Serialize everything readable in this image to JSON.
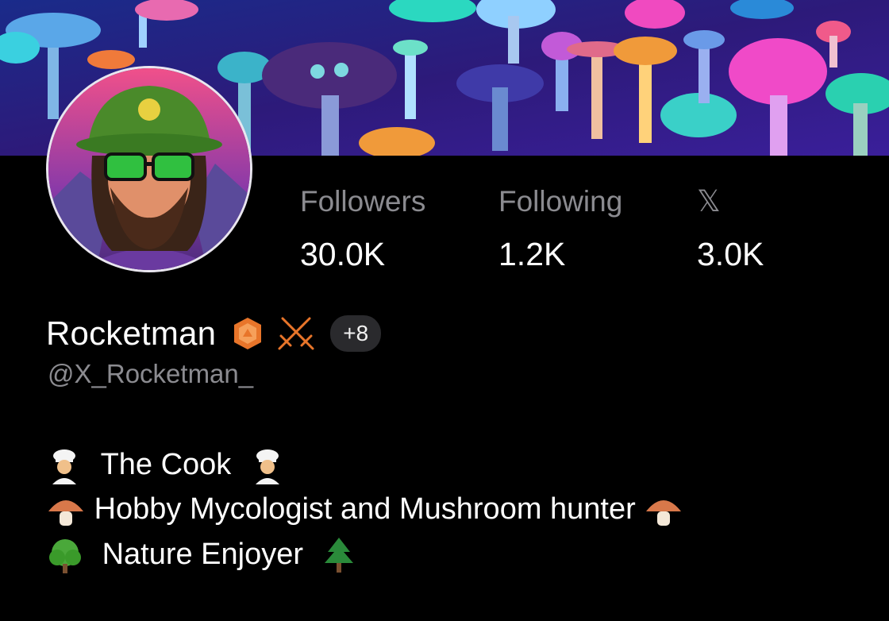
{
  "profile": {
    "display_name": "Rocketman",
    "handle": "@X_Rocketman_",
    "extra_badges": "+8"
  },
  "stats": [
    {
      "label": "Followers",
      "value": "30.0K"
    },
    {
      "label": "Following",
      "value": "1.2K"
    },
    {
      "label": "𝕏",
      "value": "3.0K"
    }
  ],
  "bio": {
    "line1_text": "The Cook",
    "line2_text": "Hobby Mycologist and Mushroom hunter",
    "line3_text": "Nature Enjoyer"
  },
  "icons": {
    "banner": "mushroom-banner-image",
    "avatar": "profile-avatar-image",
    "badge_1": "orange-hexagon-badge-icon",
    "badge_2": "crossed-swords-badge-icon",
    "x_logo": "x-logo-icon"
  },
  "colors": {
    "background": "#000000",
    "text_primary": "#ffffff",
    "text_secondary": "#8b8b90",
    "badge_orange": "#e8752a",
    "pill_bg": "#2a2a2d"
  }
}
